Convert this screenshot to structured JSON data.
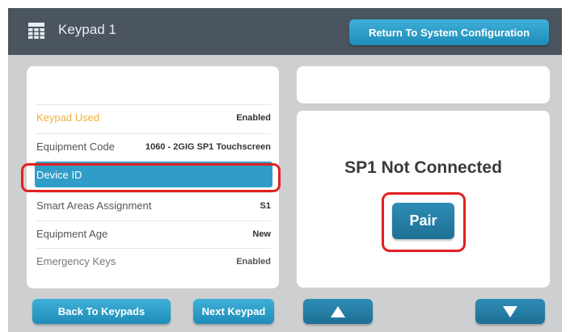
{
  "header": {
    "title": "Keypad 1",
    "icon": "keypad-grid-icon",
    "return_label": "Return To System Configuration"
  },
  "settings": [
    {
      "label": "Keypad Used",
      "value": "Enabled"
    },
    {
      "label": "Equipment Code",
      "value": "1060 - 2GIG SP1 Touchscreen"
    },
    {
      "label": "Device ID",
      "value": ""
    },
    {
      "label": "Smart Areas Assignment",
      "value": "S1"
    },
    {
      "label": "Equipment Age",
      "value": "New"
    },
    {
      "label": "Emergency Keys",
      "value": "Enabled"
    }
  ],
  "status": {
    "text": "SP1 Not Connected",
    "pair_label": "Pair"
  },
  "footer": {
    "back_label": "Back To Keypads",
    "next_label": "Next Keypad",
    "up_icon": "arrow-up-icon",
    "down_icon": "arrow-down-icon"
  },
  "colors": {
    "header_bg": "#4a5560",
    "screen_bg": "#cdcfd0",
    "accent": "#2f9dc8",
    "highlight_text": "#f0b33a",
    "annotation": "#e41f1f"
  }
}
